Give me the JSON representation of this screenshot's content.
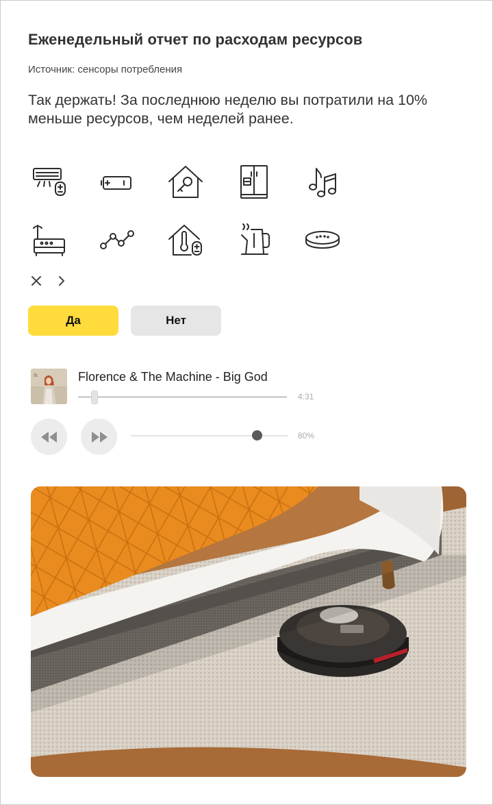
{
  "report": {
    "title": "Еженедельный отчет по расходам ресурсов",
    "source": "Источник: сенсоры потребления",
    "message": "Так держать! За последнюю неделю вы потратили на 10% меньше ресурсов, чем неделей ранее."
  },
  "devices": {
    "row1": [
      "air-conditioner-icon",
      "battery-icon",
      "smart-home-key-icon",
      "fridge-icon",
      "music-icon"
    ],
    "row2": [
      "router-icon",
      "sensor-chain-icon",
      "home-thermostat-icon",
      "kettle-icon",
      "smart-speaker-icon"
    ]
  },
  "controls": {
    "close_icon": "close-icon",
    "next_icon": "chevron-right-icon"
  },
  "buttons": {
    "yes_label": "Да",
    "no_label": "Нет"
  },
  "player": {
    "track": "Florence & The Machine - Big God",
    "duration": "4:31",
    "progress_fraction": 0.08,
    "volume_label": "80%",
    "volume_fraction": 0.8
  },
  "colors": {
    "accent_yellow": "#ffdb3b",
    "button_gray": "#e6e6e6",
    "icon_stroke": "#2b2b2b"
  }
}
